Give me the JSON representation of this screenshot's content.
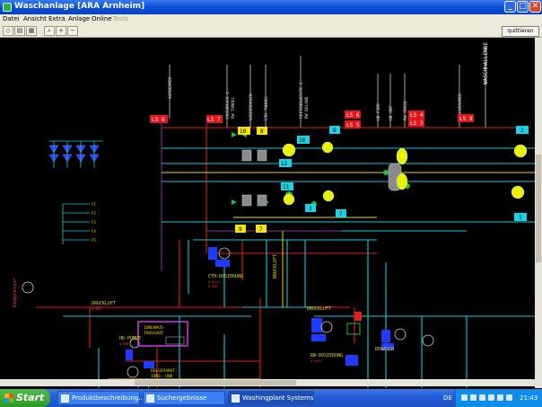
{
  "window": {
    "title": "Waschanlage [ARA Arnheim]"
  },
  "menu": [
    "Datei",
    "Ansicht",
    "Extra",
    "Anlage",
    "Online",
    "Tools"
  ],
  "toolbar": {
    "quit_label": "quittieren"
  },
  "schematic": {
    "ls_tags": [
      "LS 8",
      "LS 7",
      "LS 6",
      "LS 5",
      "LS 4",
      "LS 3",
      "LS 9"
    ],
    "yellow_nums": [
      "10",
      "8",
      "9",
      "7"
    ],
    "cyan_nums": [
      "10",
      "8",
      "12",
      "11",
      "3",
      "7",
      "2",
      "1"
    ],
    "labels": {
      "ls8": "LS 8",
      "ls7": "LS 7",
      "ls6": "LS 6",
      "ls5": "LS 5",
      "ls4": "LS 4",
      "ls3": "LS 3",
      "ls9": "LS 9",
      "waschhallende": "WASCHHALLENDE",
      "kompressor": "Kompressor",
      "druckluft1": "DRUCKLUFT",
      "druckluft2": "DRUCKLUFT",
      "druckluft3": "DRUCKLUFT",
      "cth_dosierung": "CTH-DOSIERUNG",
      "rw_dosierung": "RW-DOSIERUNG",
      "dewasch": "DEWASCH",
      "hd_pumpe": "HD-PUMPE",
      "oelseparation": "OELSEPARAT-",
      "oelseparation2": "IONS- UND",
      "oelseparation3": "WASSERSTATION",
      "ionenaus": "IONENAUS-",
      "ionenaus2": "TAUSCHER",
      "aufnehmer": "AUFNEHMER"
    }
  },
  "taskbar": {
    "start_label": "Start",
    "tasks": [
      "Produktbeschreibung...",
      "Suchergebnisse",
      "Washingplant Systems"
    ],
    "lang": "DE",
    "clock": "21:43"
  },
  "colors": {
    "ls_tag": "#e8141b",
    "yellow_num": "#f2e600",
    "cyan_num": "#19d4e6",
    "pipe_cyan": "#12c9d9",
    "pipe_red": "#e81b1b"
  }
}
